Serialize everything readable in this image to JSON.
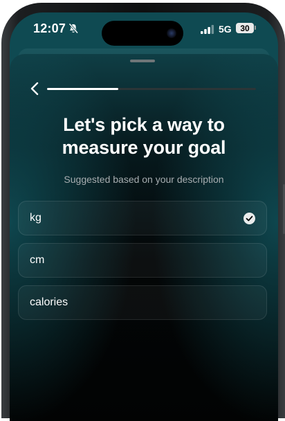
{
  "status_bar": {
    "time": "12:07",
    "network": "5G",
    "battery": "30",
    "icons": [
      "bell-off-icon",
      "camera-icon",
      "signal-icon",
      "battery-icon"
    ]
  },
  "progress": {
    "fraction": 0.34
  },
  "heading": {
    "title": "Let's pick a way to measure your goal",
    "subtitle": "Suggested based on your description"
  },
  "options": [
    {
      "label": "kg",
      "selected": true
    },
    {
      "label": "cm",
      "selected": false
    },
    {
      "label": "calories",
      "selected": false
    }
  ],
  "colors": {
    "accent": "#ffffff",
    "background_tint": "#0f4a52",
    "sheet": "#030607"
  }
}
